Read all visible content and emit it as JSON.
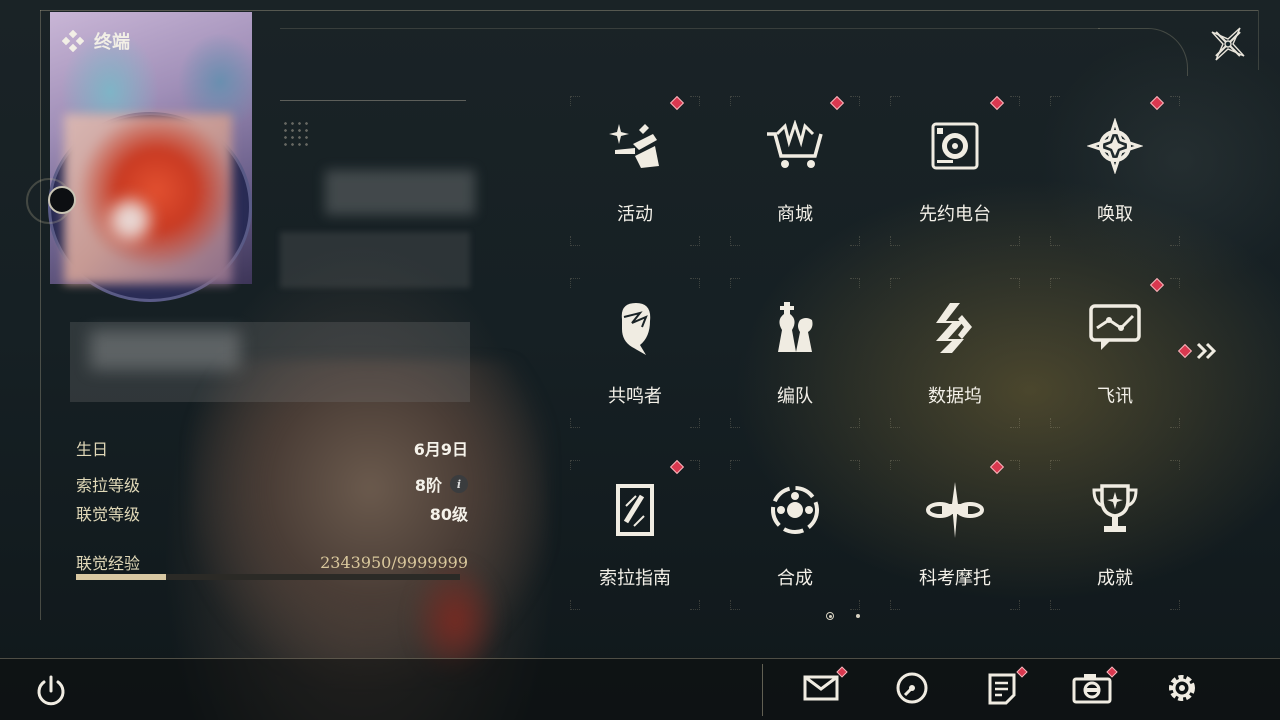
{
  "header": {
    "title": "终端"
  },
  "profile": {
    "rows": [
      {
        "key": "生日",
        "value": "6月9日"
      },
      {
        "key": "索拉等级",
        "value": "8阶"
      },
      {
        "key": "联觉等级",
        "value": "80级"
      }
    ],
    "exp": {
      "key": "联觉经验",
      "value": "2343950/9999999",
      "fraction": 0.2344
    }
  },
  "menu": [
    {
      "label": "活动",
      "icon": "sparkle-icon",
      "badge": true
    },
    {
      "label": "商城",
      "icon": "shopping-cart-icon",
      "badge": true
    },
    {
      "label": "先约电台",
      "icon": "radio-turntable-icon",
      "badge": true
    },
    {
      "label": "唤取",
      "icon": "compass-star-icon",
      "badge": true
    },
    {
      "label": "共鸣者",
      "icon": "character-head-icon",
      "badge": false
    },
    {
      "label": "编队",
      "icon": "chess-pieces-icon",
      "badge": false
    },
    {
      "label": "数据坞",
      "icon": "data-dock-icon",
      "badge": false
    },
    {
      "label": "飞讯",
      "icon": "chat-message-icon",
      "badge": true
    },
    {
      "label": "索拉指南",
      "icon": "guide-book-icon",
      "badge": true
    },
    {
      "label": "合成",
      "icon": "synthesis-icon",
      "badge": false
    },
    {
      "label": "科考摩托",
      "icon": "motorbike-icon",
      "badge": true
    },
    {
      "label": "成就",
      "icon": "trophy-icon",
      "badge": false
    }
  ],
  "pagination": {
    "current": 1,
    "total": 2
  },
  "bottom_bar": [
    {
      "icon": "mail-icon",
      "badge": true
    },
    {
      "icon": "clock-icon",
      "badge": false
    },
    {
      "icon": "notes-icon",
      "badge": true
    },
    {
      "icon": "camera-icon",
      "badge": true
    },
    {
      "icon": "settings-gear-icon",
      "badge": false
    }
  ],
  "colors": {
    "badge": "#d9384f",
    "accent": "#d8c8a2",
    "text": "#f3f0e8",
    "label": "#e0d8b8"
  }
}
